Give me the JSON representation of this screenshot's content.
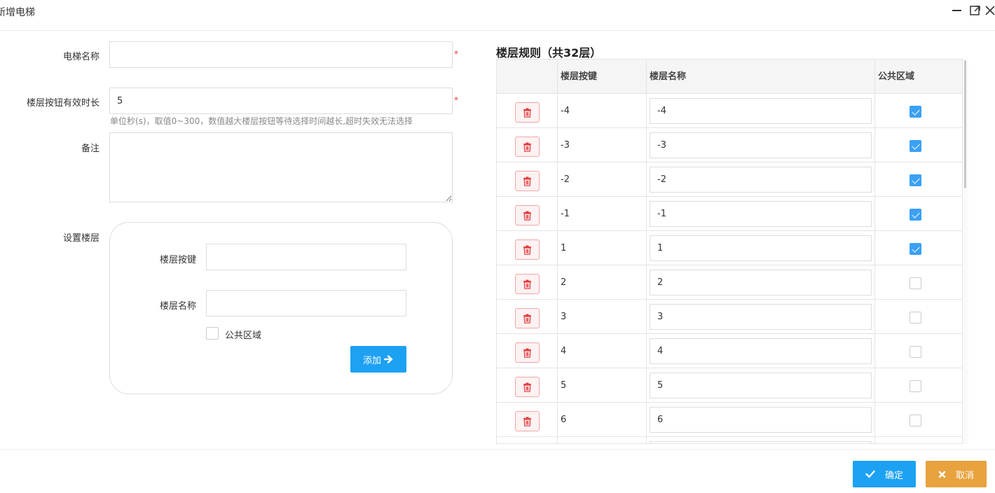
{
  "dialog": {
    "title": "新增电梯",
    "min_icon": "minimize-icon",
    "max_icon": "maximize-icon"
  },
  "form": {
    "name_label": "电梯名称",
    "name_value": "",
    "required_mark": "*",
    "duration_label": "楼层按钮有效时长",
    "duration_value": "5",
    "duration_hint": "单位秒(s)，取值0~300，数值越大楼层按钮等待选择时间越长,超时失效无法选择",
    "remark_label": "备注",
    "remark_value": "",
    "floors_label": "设置楼层"
  },
  "floor_setup": {
    "key_label": "楼层按键",
    "key_value": "",
    "name_label": "楼层名称",
    "name_value": "",
    "public_label": "公共区域",
    "public_checked": false,
    "add_label": "添加"
  },
  "rules": {
    "title": "楼层规则（共32层）",
    "headers": [
      "",
      "楼层按键",
      "楼层名称",
      "公共区域"
    ],
    "rows": [
      {
        "key": "-4",
        "name": "-4",
        "public": true
      },
      {
        "key": "-3",
        "name": "-3",
        "public": true
      },
      {
        "key": "-2",
        "name": "-2",
        "public": true
      },
      {
        "key": "-1",
        "name": "-1",
        "public": true
      },
      {
        "key": "1",
        "name": "1",
        "public": true
      },
      {
        "key": "2",
        "name": "2",
        "public": false
      },
      {
        "key": "3",
        "name": "3",
        "public": false
      },
      {
        "key": "4",
        "name": "4",
        "public": false
      },
      {
        "key": "5",
        "name": "5",
        "public": false
      },
      {
        "key": "6",
        "name": "6",
        "public": false
      },
      {
        "key": "",
        "name": "",
        "public": false
      }
    ]
  },
  "footer": {
    "ok_label": "确定",
    "cancel_label": "取消"
  },
  "colors": {
    "primary": "#1da1f2",
    "cancel": "#e8a23e",
    "danger": "#e4393c"
  }
}
